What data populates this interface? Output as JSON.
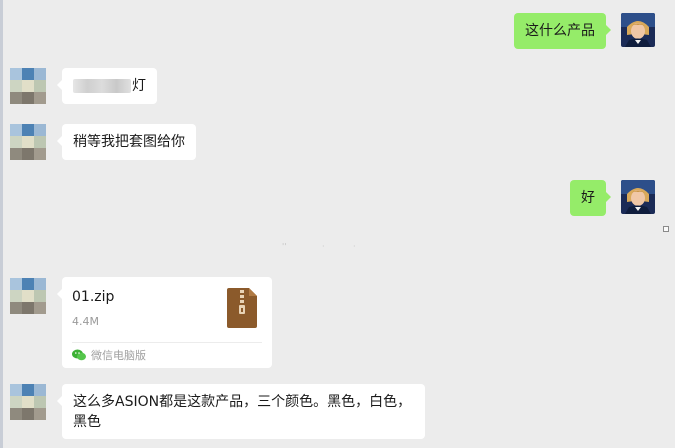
{
  "messages": {
    "m1": {
      "sender": "self",
      "text": "这什么产品"
    },
    "m2": {
      "sender": "contact",
      "text_visible": "灯"
    },
    "m3": {
      "sender": "contact",
      "text": "稍等我把套图给你"
    },
    "m4": {
      "sender": "self",
      "text": "好"
    },
    "m5": {
      "sender": "contact",
      "file": {
        "name": "01.zip",
        "size": "4.4M",
        "source": "微信电脑版",
        "icon": "zip-archive-icon"
      }
    },
    "m6": {
      "sender": "contact",
      "text_line1": "这么多ASION都是这款产品，三个颜色。黑色，白色，",
      "text_line2": "黑色"
    }
  },
  "colors": {
    "chat_bg": "#ececec",
    "outgoing_bubble": "#95ec69",
    "incoming_bubble": "#ffffff",
    "zip_icon": "#8b5a2b"
  }
}
